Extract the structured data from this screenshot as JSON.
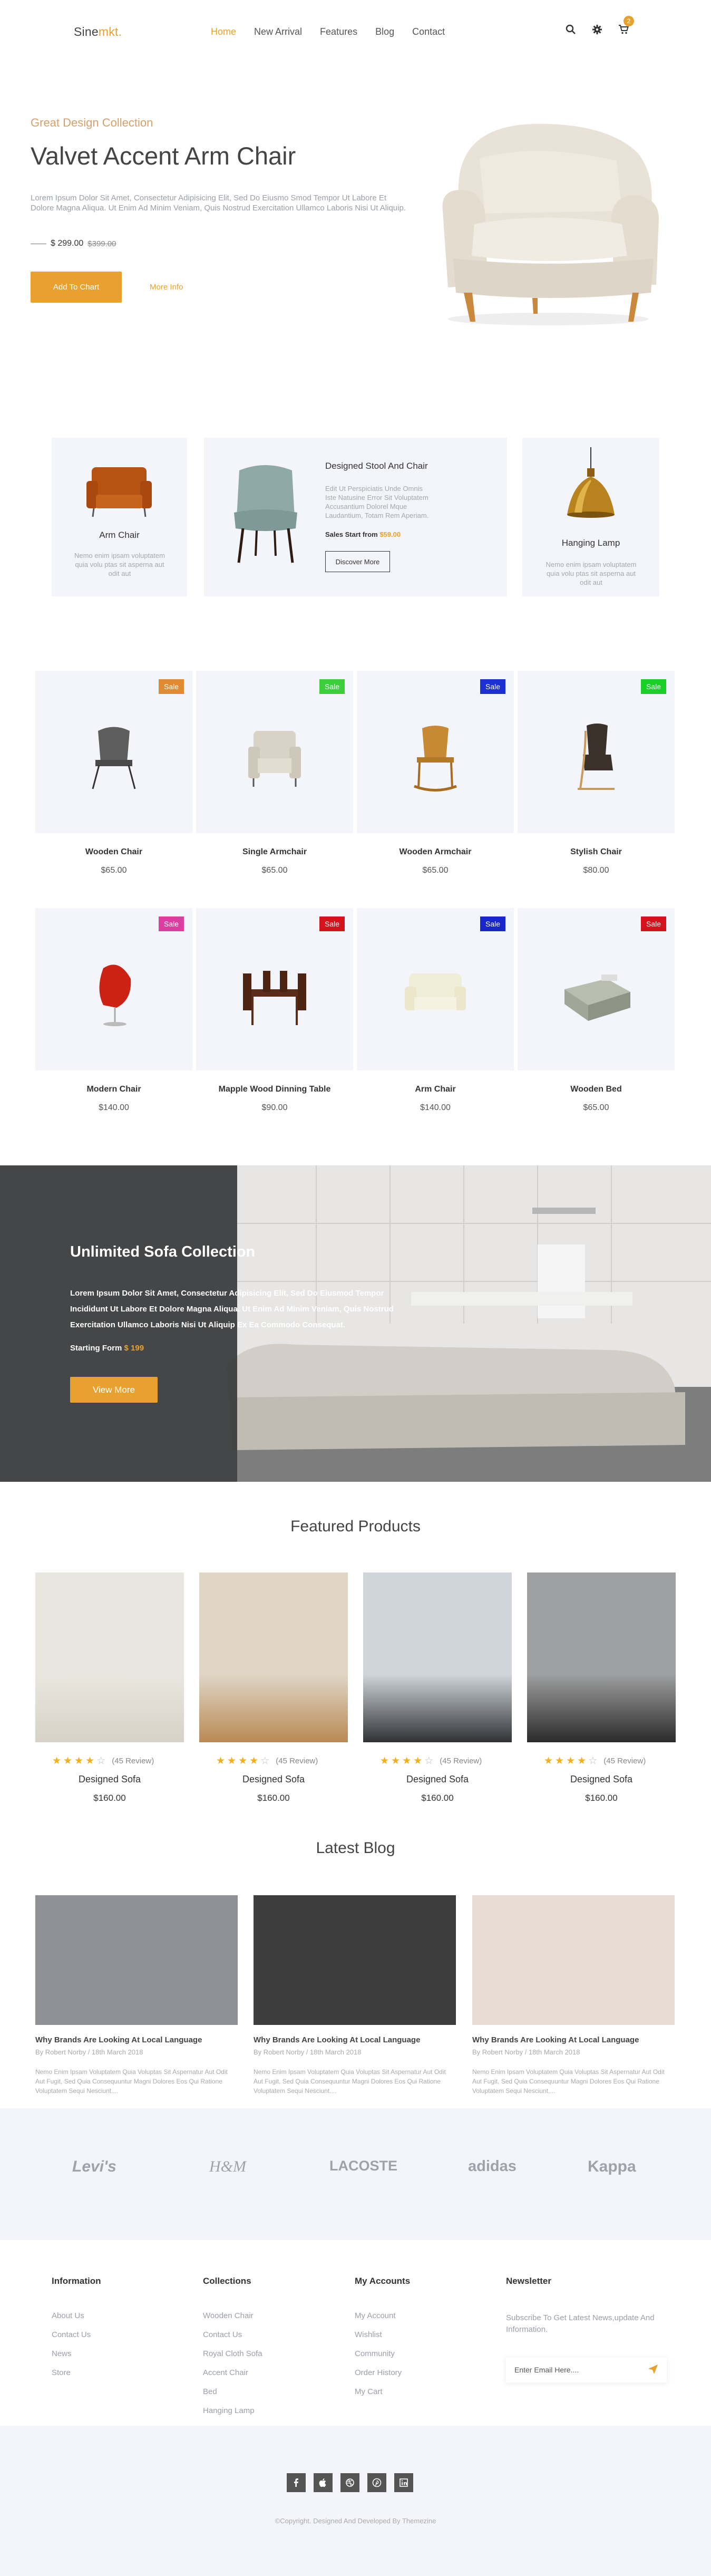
{
  "header": {
    "logo_main": "Sine",
    "logo_accent": "mkt.",
    "nav": [
      "Home",
      "New Arrival",
      "Features",
      "Blog",
      "Contact"
    ],
    "cart_count": "2",
    "icons": [
      "search-icon",
      "gear-icon",
      "cart-icon"
    ]
  },
  "hero": {
    "subtitle": "Great Design Collection",
    "title": "Valvet Accent Arm Chair",
    "description": "Lorem Ipsum Dolor Sit Amet, Consectetur Adipisicing Elit, Sed Do Eiusmo Smod Tempor Ut Labore Et Dolore Magna Aliqua. Ut Enim Ad Minim Veniam, Quis Nostrud Exercitation Ullamco Laboris Nisi Ut Aliquip.",
    "price": "$ 299.00",
    "old_price": "$399.00",
    "cta": "Add To Chart",
    "more": "More Info"
  },
  "categories": {
    "left": {
      "title": "Arm Chair",
      "desc": "Nemo enim ipsam voluptatem quia volu ptas sit asperna aut odit aut"
    },
    "middle": {
      "title": "Designed Stool And Chair",
      "desc": "Edit Ut Perspiciatis Unde Omnis Iste Natusine Error Sit Voluptatem Accusantium Dolorel Mque Laudantium, Totam Rem Aperiam.",
      "sales_label": "Sales Start from",
      "sales_price": "$59.00",
      "button": "Discover More"
    },
    "right": {
      "title": "Hanging Lamp",
      "desc": "Nemo enim ipsam voluptatem quia volu ptas sit asperna aut odit aut"
    }
  },
  "products": [
    {
      "name": "Wooden Chair",
      "price": "$65.00",
      "badge": "Sale",
      "badge_color": "#e08a32"
    },
    {
      "name": "Single Armchair",
      "price": "$65.00",
      "badge": "Sale",
      "badge_color": "#3bcf3b"
    },
    {
      "name": "Wooden Armchair",
      "price": "$65.00",
      "badge": "Sale",
      "badge_color": "#1c2fd3"
    },
    {
      "name": "Stylish Chair",
      "price": "$80.00",
      "badge": "Sale",
      "badge_color": "#19d028"
    },
    {
      "name": "Modern Chair",
      "price": "$140.00",
      "badge": "Sale",
      "badge_color": "#dc3ea0"
    },
    {
      "name": "Mapple Wood Dinning Table",
      "price": "$90.00",
      "badge": "Sale",
      "badge_color": "#d4131c"
    },
    {
      "name": "Arm Chair",
      "price": "$140.00",
      "badge": "Sale",
      "badge_color": "#1926c9"
    },
    {
      "name": "Wooden Bed",
      "price": "$65.00",
      "badge": "Sale",
      "badge_color": "#d4131c"
    }
  ],
  "sofa": {
    "title": "Unlimited Sofa Collection",
    "desc": "Lorem Ipsum Dolor Sit Amet, Consectetur Adipisicing Elit, Sed Do Eiusmod Tempor Incididunt Ut Labore Et Dolore Magna Aliqua. Ut Enim Ad Minim Veniam, Quis Nostrud Exercitation Ullamco Laboris Nisi Ut Aliquip Ex Ea Commodo Consequat.",
    "price_label": "Starting Form",
    "price": "$ 199",
    "button": "View More"
  },
  "featured": {
    "title": "Featured Products",
    "items": [
      {
        "name": "Designed Sofa",
        "price": "$160.00",
        "reviews": "(45 Review)",
        "rating": 4
      },
      {
        "name": "Designed Sofa",
        "price": "$160.00",
        "reviews": "(45 Review)",
        "rating": 4
      },
      {
        "name": "Designed Sofa",
        "price": "$160.00",
        "reviews": "(45 Review)",
        "rating": 4
      },
      {
        "name": "Designed Sofa",
        "price": "$160.00",
        "reviews": "(45 Review)",
        "rating": 4
      }
    ]
  },
  "blog": {
    "title": "Latest Blog",
    "posts": [
      {
        "title": "Why Brands Are Looking At Local Language",
        "meta": "By Robert Norby / 18th March 2018",
        "desc": "Nemo Enim Ipsam Voluptatem Quia Voluptas Sit Aspernatur Aut Odit Aut Fugit, Sed Quia Consequuntur Magni Dolores Eos Qui Ratione Voluptatem Sequi Nesciunt...."
      },
      {
        "title": "Why Brands Are Looking At Local Language",
        "meta": "By Robert Norby / 18th March 2018",
        "desc": "Nemo Enim Ipsam Voluptatem Quia Voluptas Sit Aspernatur Aut Odit Aut Fugit, Sed Quia Consequuntur Magni Dolores Eos Qui Ratione Voluptatem Sequi Nesciunt...."
      },
      {
        "title": "Why Brands Are Looking At Local Language",
        "meta": "By Robert Norby / 18th March 2018",
        "desc": "Nemo Enim Ipsam Voluptatem Quia Voluptas Sit Aspernatur Aut Odit Aut Fugit, Sed Quia Consequuntur Magni Dolores Eos Qui Ratione Voluptatem Sequi Nesciunt...."
      }
    ]
  },
  "brands": [
    "Levi's",
    "H&M",
    "LACOSTE",
    "adidas",
    "Kappa"
  ],
  "footer": {
    "information": {
      "title": "Information",
      "links": [
        "About Us",
        "Contact Us",
        "News",
        "Store"
      ]
    },
    "collections": {
      "title": "Collections",
      "links": [
        "Wooden Chair",
        "Contact Us",
        "Royal Cloth Sofa",
        "Accent Chair",
        "Bed",
        "Hanging Lamp"
      ]
    },
    "accounts": {
      "title": "My Accounts",
      "links": [
        "My Account",
        "Wishlist",
        "Community",
        "Order History",
        "My Cart"
      ]
    },
    "newsletter": {
      "title": "Newsletter",
      "text": "Subscribe To Get Latest News,update And Information.",
      "placeholder": "Enter Email Here...."
    },
    "social": [
      "facebook-icon",
      "apple-icon",
      "dribbble-icon",
      "pinterest-icon",
      "linkedin-icon"
    ],
    "copyright": "©Copyright. Designed And Developed By Themezine"
  },
  "colors": {
    "accent": "#e8a12e",
    "card_bg": "#f4f5fa",
    "dark": "#3b3b3b"
  }
}
